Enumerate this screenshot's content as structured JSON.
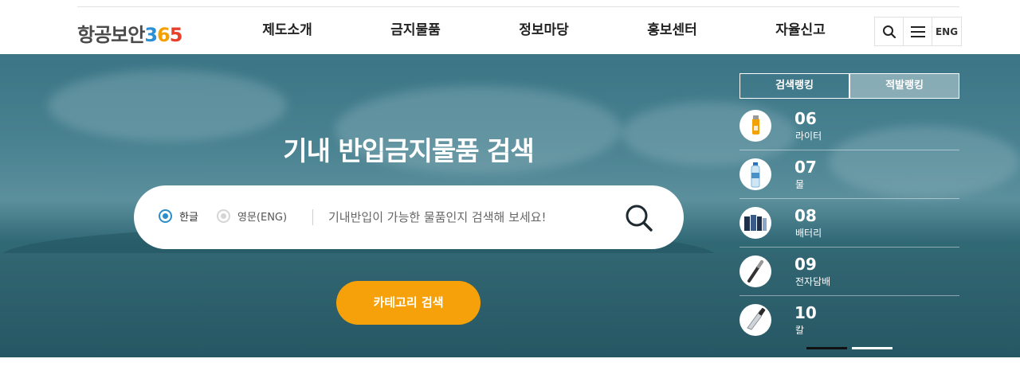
{
  "header": {
    "logo_text": "항공보안",
    "logo_num_1": "3",
    "logo_num_2": "6",
    "logo_num_3": "5",
    "nav": [
      "제도소개",
      "금지물품",
      "정보마당",
      "홍보센터",
      "자율신고"
    ],
    "eng_label": "ENG",
    "icons": {
      "search": "search-icon",
      "menu": "hamburger-menu-icon"
    }
  },
  "hero": {
    "title": "기내 반입금지물품 검색",
    "radio_korean": "한글",
    "radio_english": "영문(ENG)",
    "search_placeholder": "기내반입이 가능한 물품인지 검색해 보세요!",
    "category_button": "카테고리 검색"
  },
  "ranking": {
    "tabs": [
      "검색랭킹",
      "적발랭킹"
    ],
    "active_tab": "검색랭킹",
    "items": [
      {
        "rank": "06",
        "name": "라이터",
        "icon": "lighter-icon"
      },
      {
        "rank": "07",
        "name": "물",
        "icon": "water-bottle-icon"
      },
      {
        "rank": "08",
        "name": "배터리",
        "icon": "battery-icon"
      },
      {
        "rank": "09",
        "name": "전자담배",
        "icon": "e-cigarette-icon"
      },
      {
        "rank": "10",
        "name": "칼",
        "icon": "knife-icon"
      }
    ]
  },
  "colors": {
    "accent_orange": "#f6a10a",
    "radio_blue": "#2b8ec9",
    "logo_3": "#2b8fd6",
    "logo_6": "#f4a100",
    "logo_5": "#e8412b"
  }
}
